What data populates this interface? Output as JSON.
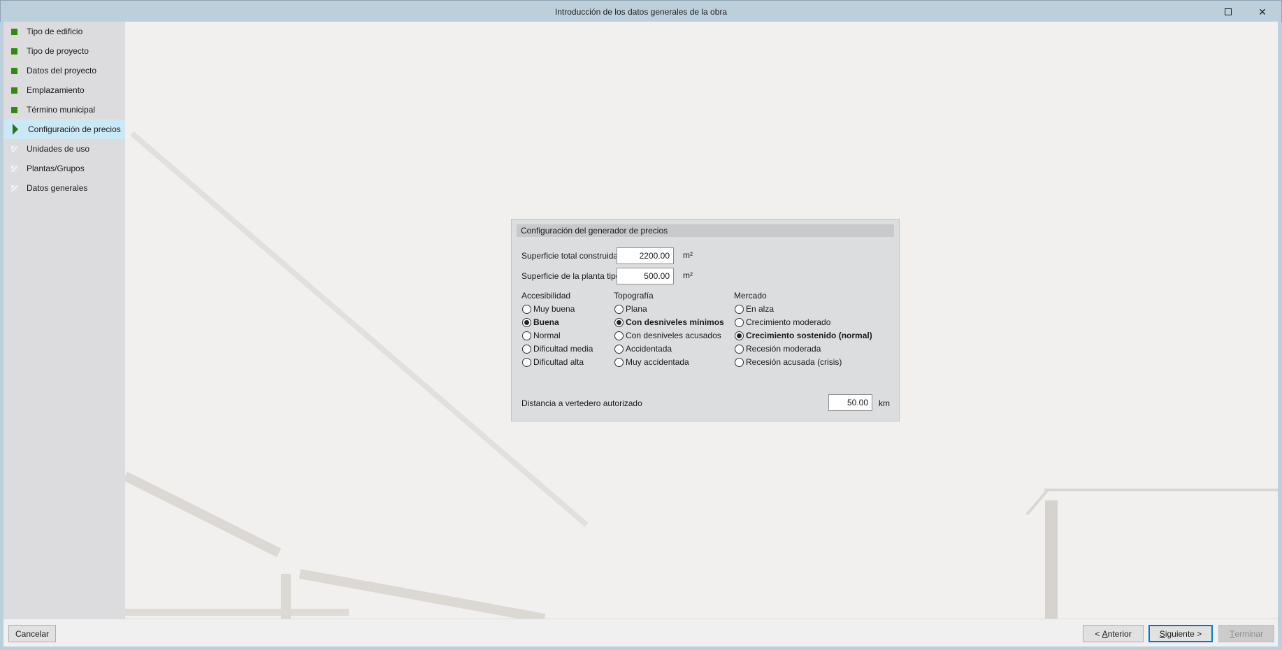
{
  "window": {
    "title": "Introducción de los datos generales de la obra",
    "maximize_icon": "maximize-icon",
    "close_icon": "close-icon"
  },
  "sidebar": {
    "items": [
      {
        "label": "Tipo de edificio",
        "status": "done"
      },
      {
        "label": "Tipo de proyecto",
        "status": "done"
      },
      {
        "label": "Datos del proyecto",
        "status": "done"
      },
      {
        "label": "Emplazamiento",
        "status": "done"
      },
      {
        "label": "Término municipal",
        "status": "done"
      },
      {
        "label": "Configuración de precios",
        "status": "current"
      },
      {
        "label": "Unidades de uso",
        "status": "pending"
      },
      {
        "label": "Plantas/Grupos",
        "status": "pending"
      },
      {
        "label": "Datos generales",
        "status": "pending"
      }
    ]
  },
  "panel": {
    "title": "Configuración del generador de precios",
    "superficie_total": {
      "label": "Superficie total construida",
      "value": "2200.00",
      "unit": "m²"
    },
    "superficie_planta": {
      "label": "Superficie de la planta tipo",
      "value": "500.00",
      "unit": "m²"
    },
    "accesibilidad": {
      "label": "Accesibilidad",
      "options": [
        "Muy buena",
        "Buena",
        "Normal",
        "Dificultad media",
        "Dificultad alta"
      ],
      "selected": "Buena"
    },
    "topografia": {
      "label": "Topografía",
      "options": [
        "Plana",
        "Con desniveles mínimos",
        "Con desniveles acusados",
        "Accidentada",
        "Muy accidentada"
      ],
      "selected": "Con desniveles mínimos"
    },
    "mercado": {
      "label": "Mercado",
      "options": [
        "En alza",
        "Crecimiento moderado",
        "Crecimiento sostenido (normal)",
        "Recesión moderada",
        "Recesión acusada (crisis)"
      ],
      "selected": "Crecimiento sostenido (normal)"
    },
    "distancia": {
      "label": "Distancia a vertedero autorizado",
      "value": "50.00",
      "unit": "km"
    }
  },
  "footer": {
    "cancel": "Cancelar",
    "prev_arrow": "< ",
    "prev_key": "A",
    "prev_rest": "nterior",
    "next_key": "S",
    "next_rest": "iguiente >",
    "finish_key": "T",
    "finish_rest": "erminar"
  }
}
